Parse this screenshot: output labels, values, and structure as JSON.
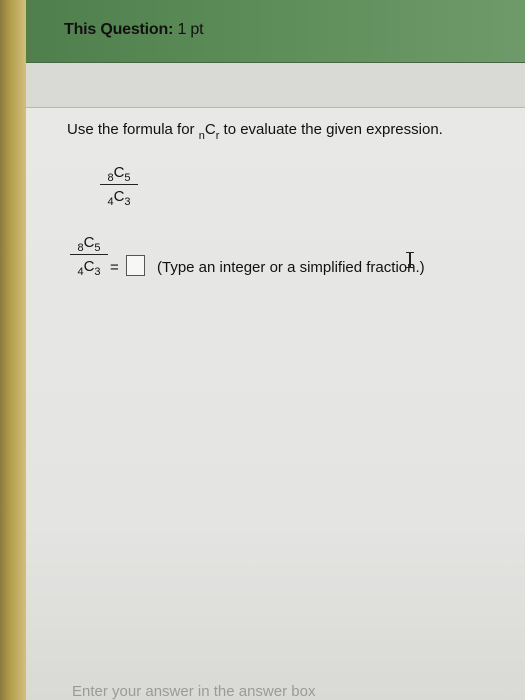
{
  "header": {
    "title_bold": "This Question:",
    "points": " 1 pt"
  },
  "prompt": {
    "lead": "Use the formula for ",
    "n_sub": "n",
    "c": "C",
    "r_sub": "r",
    "tail": " to evaluate the given expression."
  },
  "expression": {
    "numerator_pre": "8",
    "numerator_c": "C",
    "numerator_post": "5",
    "denominator_pre": "4",
    "denominator_c": "C",
    "denominator_post": "3"
  },
  "answer": {
    "equals": "=",
    "value": "",
    "hint": "(Type an integer or a simplified fraction.)"
  },
  "footer": {
    "text": "Enter your answer in the answer box"
  },
  "colors": {
    "header_green": "#5f8f5a",
    "background": "#e3e3e1"
  }
}
